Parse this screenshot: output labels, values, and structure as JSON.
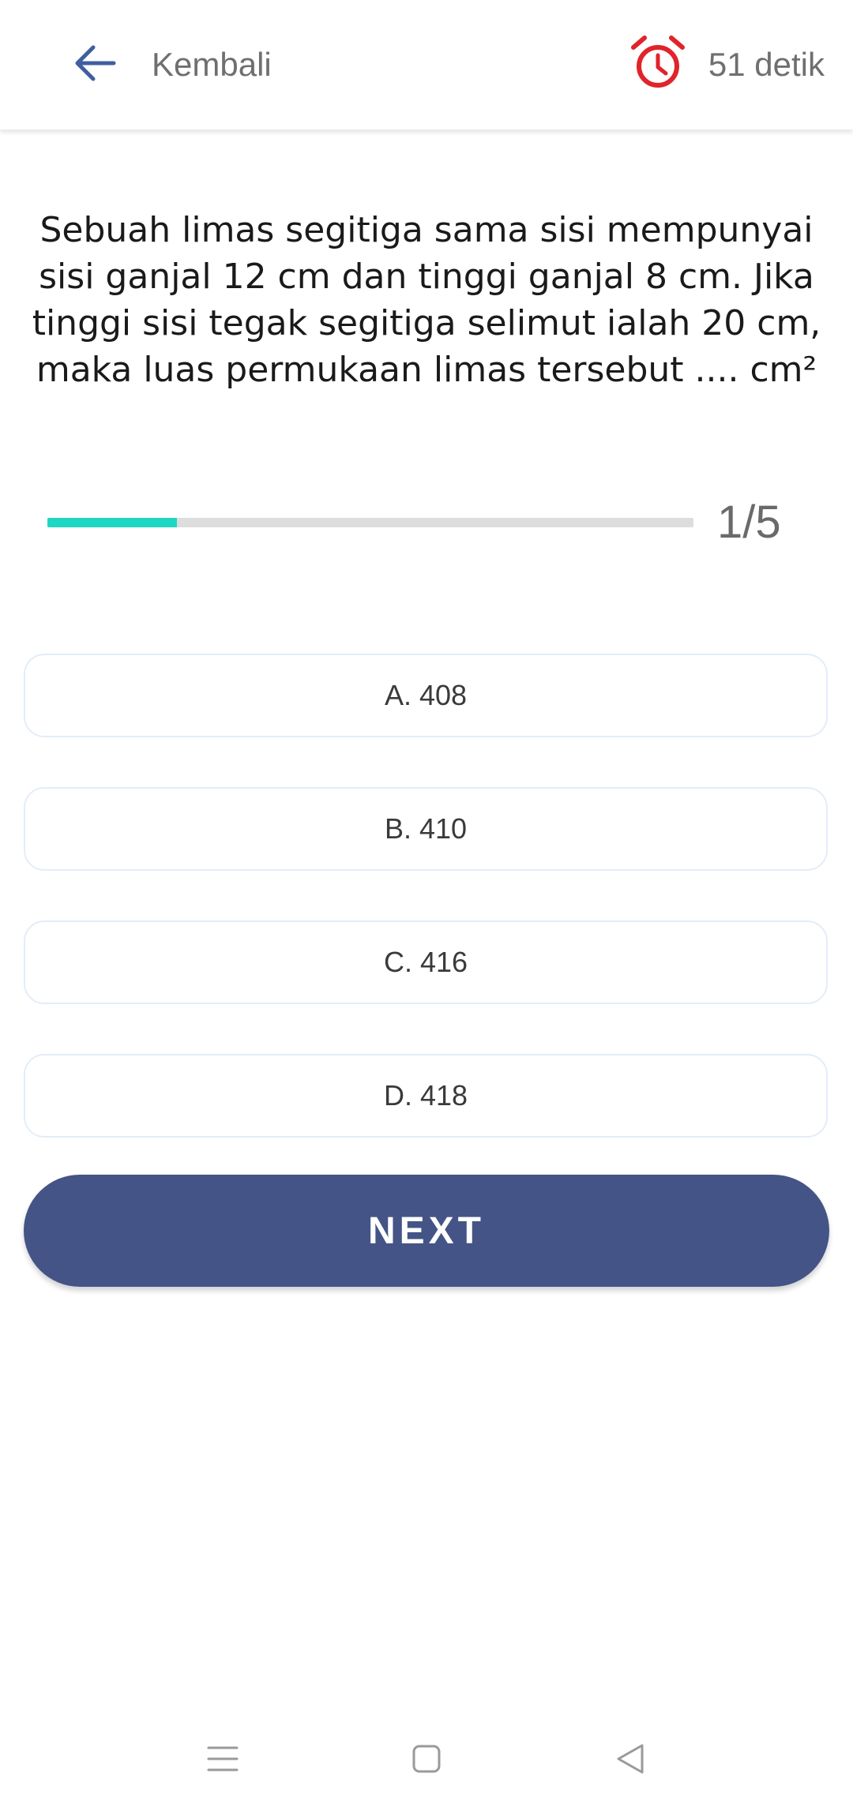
{
  "header": {
    "back_label": "Kembali",
    "back_icon": "arrow-left-icon",
    "timer_icon": "alarm-clock-icon",
    "timer_text": "51 detik",
    "accent_color": "#3f5f9e",
    "timer_color": "#e0242a"
  },
  "question": {
    "text": "Sebuah limas segitiga sama sisi mempunyai sisi ganjal 12 cm dan tinggi ganjal 8 cm. Jika tinggi sisi tegak segitiga selimut ialah 20 cm, maka luas permukaan limas tersebut ....  cm²"
  },
  "progress": {
    "current": 1,
    "total": 5,
    "label": "1/5",
    "fraction": 0.2,
    "fill_color": "#1fd6c2",
    "track_color": "#dddddd"
  },
  "options": [
    {
      "label": "A. 408"
    },
    {
      "label": "B. 410"
    },
    {
      "label": "C. 416"
    },
    {
      "label": "D. 418"
    }
  ],
  "next_button": {
    "label": "NEXT",
    "color": "#445486"
  },
  "system_nav": {
    "icons": [
      "menu-icon",
      "home-icon",
      "back-triangle-icon"
    ]
  }
}
